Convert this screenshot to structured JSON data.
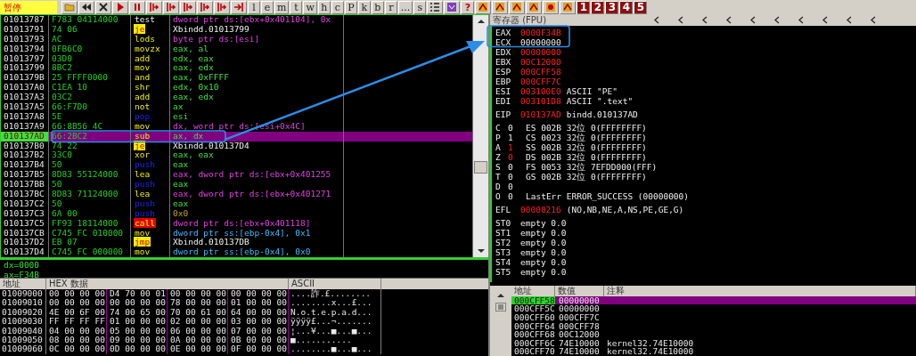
{
  "toolbar": {
    "status": "暂停",
    "letter_buttons": [
      "l",
      "e",
      "m",
      "t",
      "w",
      "h",
      "c",
      "P",
      "k",
      "b",
      "r",
      "...",
      "s"
    ],
    "help_button": "?",
    "numbered_buttons": [
      "1",
      "2",
      "3",
      "4",
      "5"
    ]
  },
  "disassembly": {
    "rows": [
      {
        "address": "01013787",
        "hex": "F783 04114000",
        "mnemonic": "test",
        "kind": "plain",
        "operands": {
          "text": "dword ptr ds:[ebx+0x401104], 0x",
          "kind": "mem"
        },
        "selected": false
      },
      {
        "address": "01013791",
        "hex": "74 06",
        "mnemonic": "je",
        "kind": "jump",
        "operands": {
          "text": "Xbindd.01013799",
          "kind": "label"
        },
        "selected": false
      },
      {
        "address": "01013793",
        "hex": "AC",
        "mnemonic": "lods",
        "kind": "normal",
        "operands": {
          "text": "byte ptr ds:[esi]",
          "kind": "mem"
        },
        "selected": false
      },
      {
        "address": "01013794",
        "hex": "0FB6C0",
        "mnemonic": "movzx",
        "kind": "normal",
        "operands": {
          "text": "eax, al",
          "kind": "reg"
        },
        "selected": false
      },
      {
        "address": "01013797",
        "hex": "03D0",
        "mnemonic": "add",
        "kind": "normal",
        "operands": {
          "text": "edx, eax",
          "kind": "reg"
        },
        "selected": false
      },
      {
        "address": "01013799",
        "hex": "8BC2",
        "mnemonic": "mov",
        "kind": "normal",
        "operands": {
          "text": "eax, edx",
          "kind": "reg"
        },
        "selected": false
      },
      {
        "address": "0101379B",
        "hex": "25 FFFF0000",
        "mnemonic": "and",
        "kind": "normal",
        "operands": {
          "text": "eax, 0xFFFF",
          "kind": "reg"
        },
        "selected": false
      },
      {
        "address": "010137A0",
        "hex": "C1EA 10",
        "mnemonic": "shr",
        "kind": "normal",
        "operands": {
          "text": "edx, 0x10",
          "kind": "reg"
        },
        "selected": false
      },
      {
        "address": "010137A3",
        "hex": "03C2",
        "mnemonic": "add",
        "kind": "normal",
        "operands": {
          "text": "eax, edx",
          "kind": "reg"
        },
        "selected": false
      },
      {
        "address": "010137A5",
        "hex": "66:F7D0",
        "mnemonic": "not",
        "kind": "normal",
        "operands": {
          "text": "ax",
          "kind": "reg"
        },
        "selected": false
      },
      {
        "address": "010137A8",
        "hex": "5E",
        "mnemonic": "pop",
        "kind": "stack",
        "operands": {
          "text": "esi",
          "kind": "reg"
        },
        "selected": false
      },
      {
        "address": "010137A9",
        "hex": "66:8B56 4C",
        "mnemonic": "mov",
        "kind": "normal",
        "operands": {
          "text": "dx, word ptr ds:[esi+0x4C]",
          "kind": "mem"
        },
        "selected": false
      },
      {
        "address": "010137AD",
        "hex": "66:2BC2",
        "mnemonic": "sub",
        "kind": "normal",
        "operands": {
          "text": "ax, dx",
          "kind": "reg"
        },
        "selected": true
      },
      {
        "address": "010137B0",
        "hex": "74 22",
        "mnemonic": "je",
        "kind": "jump",
        "operands": {
          "text": "Xbindd.010137D4",
          "kind": "label"
        },
        "selected": false
      },
      {
        "address": "010137B2",
        "hex": "33C0",
        "mnemonic": "xor",
        "kind": "normal",
        "operands": {
          "text": "eax, eax",
          "kind": "reg"
        },
        "selected": false
      },
      {
        "address": "010137B4",
        "hex": "50",
        "mnemonic": "push",
        "kind": "stack",
        "operands": {
          "text": "eax",
          "kind": "reg"
        },
        "selected": false
      },
      {
        "address": "010137B5",
        "hex": "8D83 55124000",
        "mnemonic": "lea",
        "kind": "normal",
        "operands": {
          "text": "eax, dword ptr ds:[ebx+0x401255",
          "kind": "mem"
        },
        "selected": false
      },
      {
        "address": "010137BB",
        "hex": "50",
        "mnemonic": "push",
        "kind": "stack",
        "operands": {
          "text": "eax",
          "kind": "reg"
        },
        "selected": false
      },
      {
        "address": "010137BC",
        "hex": "8D83 71124000",
        "mnemonic": "lea",
        "kind": "normal",
        "operands": {
          "text": "eax, dword ptr ds:[ebx+0x401271",
          "kind": "mem"
        },
        "selected": false
      },
      {
        "address": "010137C2",
        "hex": "50",
        "mnemonic": "push",
        "kind": "stack",
        "operands": {
          "text": "eax",
          "kind": "reg"
        },
        "selected": false
      },
      {
        "address": "010137C3",
        "hex": "6A 00",
        "mnemonic": "push",
        "kind": "stack",
        "operands": {
          "text": "0x0",
          "kind": "imm"
        },
        "selected": false
      },
      {
        "address": "010137C5",
        "hex": "FF93 18114000",
        "mnemonic": "call",
        "kind": "call",
        "operands": {
          "text": "dword ptr ds:[ebx+0x401118]",
          "kind": "mem"
        },
        "selected": false
      },
      {
        "address": "010137CB",
        "hex": "C745 FC 010000",
        "mnemonic": "mov",
        "kind": "normal",
        "operands": {
          "text": "dword ptr ss:[ebp-0x4], 0x1",
          "kind": "stack_mem"
        },
        "selected": false
      },
      {
        "address": "010137D2",
        "hex": "EB 07",
        "mnemonic": "jmp",
        "kind": "jump",
        "operands": {
          "text": "Xbindd.010137DB",
          "kind": "label"
        },
        "selected": false
      },
      {
        "address": "010137D4",
        "hex": "C745 FC 000000",
        "mnemonic": "mov",
        "kind": "normal",
        "operands": {
          "text": "dword ptr ss:[ebp-0x4], 0x0",
          "kind": "stack_mem"
        },
        "selected": false
      }
    ]
  },
  "info_pane": {
    "lines": [
      "dx=0000",
      "ax=F34B"
    ]
  },
  "registers": {
    "title": "寄存器 (FPU)",
    "groups": [
      [
        {
          "kind": "reg",
          "name": "EAX",
          "value": "0000F34B",
          "changed": true
        },
        {
          "kind": "reg",
          "name": "ECX",
          "value": "00000000",
          "changed": false
        },
        {
          "kind": "reg",
          "name": "EDX",
          "value": "00000000",
          "changed": true
        },
        {
          "kind": "reg",
          "name": "EBX",
          "value": "00C12000",
          "changed": true
        },
        {
          "kind": "reg",
          "name": "ESP",
          "value": "000CFF58",
          "changed": true
        },
        {
          "kind": "reg",
          "name": "EBP",
          "value": "000CFF7C",
          "changed": true
        },
        {
          "kind": "reg",
          "name": "ESI",
          "value": "003100E0",
          "changed": true,
          "comment": "ASCII \"PE\""
        },
        {
          "kind": "reg",
          "name": "EDI",
          "value": "003101D8",
          "changed": true,
          "comment": "ASCII \".text\""
        }
      ],
      [
        {
          "kind": "reg",
          "name": "EIP",
          "value": "010137AD",
          "changed": true,
          "comment": "bindd.010137AD"
        }
      ],
      [
        {
          "kind": "flag",
          "name": "C",
          "value": "0",
          "changed": false,
          "comment": "ES 002B 32位  0(FFFFFFFF)"
        },
        {
          "kind": "flag",
          "name": "P",
          "value": "1",
          "changed": false,
          "comment": "CS 0023 32位  0(FFFFFFFF)"
        },
        {
          "kind": "flag",
          "name": "A",
          "value": "1",
          "changed": true,
          "comment": "SS 002B 32位  0(FFFFFFFF)"
        },
        {
          "kind": "flag",
          "name": "Z",
          "value": "0",
          "changed": true,
          "comment": "DS 002B 32位  0(FFFFFFFF)"
        },
        {
          "kind": "flag",
          "name": "S",
          "value": "0",
          "changed": false,
          "comment": "FS 0053 32位  7EFDD000(FFF)"
        },
        {
          "kind": "flag",
          "name": "T",
          "value": "0",
          "changed": false,
          "comment": "GS 002B 32位  0(FFFFFFFF)"
        },
        {
          "kind": "flag",
          "name": "D",
          "value": "0",
          "changed": false
        },
        {
          "kind": "flag",
          "name": "O",
          "value": "0",
          "changed": false,
          "comment": "LastErr ERROR_SUCCESS (00000000)"
        }
      ],
      [
        {
          "kind": "reg",
          "name": "EFL",
          "value": "00000216",
          "changed": true,
          "comment": "(NO,NB,NE,A,NS,PE,GE,G)"
        }
      ],
      [
        {
          "kind": "fpu",
          "name": "ST0",
          "value": "empty 0.0"
        },
        {
          "kind": "fpu",
          "name": "ST1",
          "value": "empty 0.0"
        },
        {
          "kind": "fpu",
          "name": "ST2",
          "value": "empty 0.0"
        },
        {
          "kind": "fpu",
          "name": "ST3",
          "value": "empty 0.0"
        },
        {
          "kind": "fpu",
          "name": "ST4",
          "value": "empty 0.0"
        },
        {
          "kind": "fpu",
          "name": "ST5",
          "value": "empty 0.0"
        }
      ]
    ]
  },
  "dump": {
    "columns": [
      "地址",
      "HEX 数据",
      "ASCII"
    ],
    "rows": [
      {
        "address": "01009000",
        "bytes": [
          "00 00 00 00",
          "D4 70 00 01",
          "00 00 00 00",
          "00 00 00 00"
        ],
        "ascii": "....詐.£........"
      },
      {
        "address": "01009010",
        "bytes": [
          "00 00 00 00",
          "00 00 00 00",
          "78 00 00 00",
          "01 00 00 00"
        ],
        "ascii": "........x...£..."
      },
      {
        "address": "01009020",
        "bytes": [
          "4E 00 6F 00",
          "74 00 65 00",
          "70 00 61 00",
          "64 00 00 00"
        ],
        "ascii": "N.o.t.e.p.a.d..."
      },
      {
        "address": "01009030",
        "bytes": [
          "FF FF FF FF",
          "01 00 00 00",
          "02 00 00 00",
          "03 00 00 00"
        ],
        "ascii": "ÿÿÿÿ£...¬......."
      },
      {
        "address": "01009040",
        "bytes": [
          "04 00 00 00",
          "05 00 00 00",
          "06 00 00 00",
          "07 00 00 00"
        ],
        "ascii": "¦...¥...■...■..."
      },
      {
        "address": "01009050",
        "bytes": [
          "08 00 00 00",
          "09 00 00 00",
          "0A 00 00 00",
          "0B 00 00 00"
        ],
        "ascii": "■..........."
      },
      {
        "address": "01009060",
        "bytes": [
          "0C 00 00 00",
          "0D 00 00 00",
          "0E 00 00 00",
          "0F 00 00 00"
        ],
        "ascii": "........■...■..."
      }
    ]
  },
  "stack": {
    "columns": [
      "地址",
      "数值",
      "注释"
    ],
    "rows": [
      {
        "address": "000CFF58",
        "value": "00000000",
        "selected": true
      },
      {
        "address": "000CFF5C",
        "value": "00000000",
        "selected": false
      },
      {
        "address": "000CFF60",
        "value": "000CFF7C",
        "selected": false
      },
      {
        "address": "000CFF64",
        "value": "000CFF78",
        "selected": false
      },
      {
        "address": "000CFF68",
        "value": "00C12000",
        "selected": false
      },
      {
        "address": "000CFF6C",
        "value": "74E10000",
        "comment": "kernel32.74E10000",
        "selected": false
      },
      {
        "address": "000CFF70",
        "value": "74E10000",
        "comment": "kernel32.74E10000",
        "selected": false
      }
    ]
  }
}
